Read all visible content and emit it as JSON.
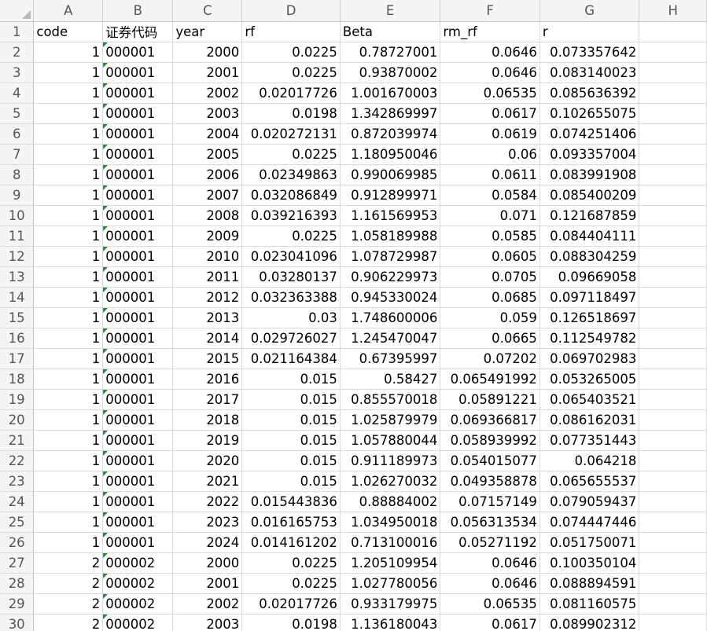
{
  "columns": [
    "A",
    "B",
    "C",
    "D",
    "E",
    "F",
    "G",
    "H"
  ],
  "header_row": {
    "num": "1",
    "cells": [
      "code",
      "证券代码",
      "year",
      "rf",
      "Beta",
      "rm_rf",
      "r",
      ""
    ]
  },
  "rows": [
    {
      "num": "2",
      "cells": [
        "1",
        "000001",
        "2000",
        "0.0225",
        "0.78727001",
        "0.0646",
        "0.073357642",
        ""
      ]
    },
    {
      "num": "3",
      "cells": [
        "1",
        "000001",
        "2001",
        "0.0225",
        "0.93870002",
        "0.0646",
        "0.083140023",
        ""
      ]
    },
    {
      "num": "4",
      "cells": [
        "1",
        "000001",
        "2002",
        "0.02017726",
        "1.001670003",
        "0.06535",
        "0.085636392",
        ""
      ]
    },
    {
      "num": "5",
      "cells": [
        "1",
        "000001",
        "2003",
        "0.0198",
        "1.342869997",
        "0.0617",
        "0.102655075",
        ""
      ]
    },
    {
      "num": "6",
      "cells": [
        "1",
        "000001",
        "2004",
        "0.020272131",
        "0.872039974",
        "0.0619",
        "0.074251406",
        ""
      ]
    },
    {
      "num": "7",
      "cells": [
        "1",
        "000001",
        "2005",
        "0.0225",
        "1.180950046",
        "0.06",
        "0.093357004",
        ""
      ]
    },
    {
      "num": "8",
      "cells": [
        "1",
        "000001",
        "2006",
        "0.02349863",
        "0.990069985",
        "0.0611",
        "0.083991908",
        ""
      ]
    },
    {
      "num": "9",
      "cells": [
        "1",
        "000001",
        "2007",
        "0.032086849",
        "0.912899971",
        "0.0584",
        "0.085400209",
        ""
      ]
    },
    {
      "num": "10",
      "cells": [
        "1",
        "000001",
        "2008",
        "0.039216393",
        "1.161569953",
        "0.071",
        "0.121687859",
        ""
      ]
    },
    {
      "num": "11",
      "cells": [
        "1",
        "000001",
        "2009",
        "0.0225",
        "1.058189988",
        "0.0585",
        "0.084404111",
        ""
      ]
    },
    {
      "num": "12",
      "cells": [
        "1",
        "000001",
        "2010",
        "0.023041096",
        "1.078729987",
        "0.0605",
        "0.088304259",
        ""
      ]
    },
    {
      "num": "13",
      "cells": [
        "1",
        "000001",
        "2011",
        "0.03280137",
        "0.906229973",
        "0.0705",
        "0.09669058",
        ""
      ]
    },
    {
      "num": "14",
      "cells": [
        "1",
        "000001",
        "2012",
        "0.032363388",
        "0.945330024",
        "0.0685",
        "0.097118497",
        ""
      ]
    },
    {
      "num": "15",
      "cells": [
        "1",
        "000001",
        "2013",
        "0.03",
        "1.748600006",
        "0.059",
        "0.126518697",
        ""
      ]
    },
    {
      "num": "16",
      "cells": [
        "1",
        "000001",
        "2014",
        "0.029726027",
        "1.245470047",
        "0.0665",
        "0.112549782",
        ""
      ]
    },
    {
      "num": "17",
      "cells": [
        "1",
        "000001",
        "2015",
        "0.021164384",
        "0.67395997",
        "0.07202",
        "0.069702983",
        ""
      ]
    },
    {
      "num": "18",
      "cells": [
        "1",
        "000001",
        "2016",
        "0.015",
        "0.58427",
        "0.065491992",
        "0.053265005",
        ""
      ]
    },
    {
      "num": "19",
      "cells": [
        "1",
        "000001",
        "2017",
        "0.015",
        "0.855570018",
        "0.05891221",
        "0.065403521",
        ""
      ]
    },
    {
      "num": "20",
      "cells": [
        "1",
        "000001",
        "2018",
        "0.015",
        "1.025879979",
        "0.069366817",
        "0.086162031",
        ""
      ]
    },
    {
      "num": "21",
      "cells": [
        "1",
        "000001",
        "2019",
        "0.015",
        "1.057880044",
        "0.058939992",
        "0.077351443",
        ""
      ]
    },
    {
      "num": "22",
      "cells": [
        "1",
        "000001",
        "2020",
        "0.015",
        "0.911189973",
        "0.054015077",
        "0.064218",
        ""
      ]
    },
    {
      "num": "23",
      "cells": [
        "1",
        "000001",
        "2021",
        "0.015",
        "1.026270032",
        "0.049358878",
        "0.065655537",
        ""
      ]
    },
    {
      "num": "24",
      "cells": [
        "1",
        "000001",
        "2022",
        "0.015443836",
        "0.88884002",
        "0.07157149",
        "0.079059437",
        ""
      ]
    },
    {
      "num": "25",
      "cells": [
        "1",
        "000001",
        "2023",
        "0.016165753",
        "1.034950018",
        "0.056313534",
        "0.074447446",
        ""
      ]
    },
    {
      "num": "26",
      "cells": [
        "1",
        "000001",
        "2024",
        "0.014161202",
        "0.713100016",
        "0.05271192",
        "0.051750071",
        ""
      ]
    },
    {
      "num": "27",
      "cells": [
        "2",
        "000002",
        "2000",
        "0.0225",
        "1.205109954",
        "0.0646",
        "0.100350104",
        ""
      ]
    },
    {
      "num": "28",
      "cells": [
        "2",
        "000002",
        "2001",
        "0.0225",
        "1.027780056",
        "0.0646",
        "0.088894591",
        ""
      ]
    },
    {
      "num": "29",
      "cells": [
        "2",
        "000002",
        "2002",
        "0.02017726",
        "0.933179975",
        "0.06535",
        "0.081160575",
        ""
      ]
    },
    {
      "num": "30",
      "cells": [
        "2",
        "000002",
        "2003",
        "0.0198",
        "1.136180043",
        "0.0617",
        "0.089902312",
        ""
      ]
    }
  ]
}
